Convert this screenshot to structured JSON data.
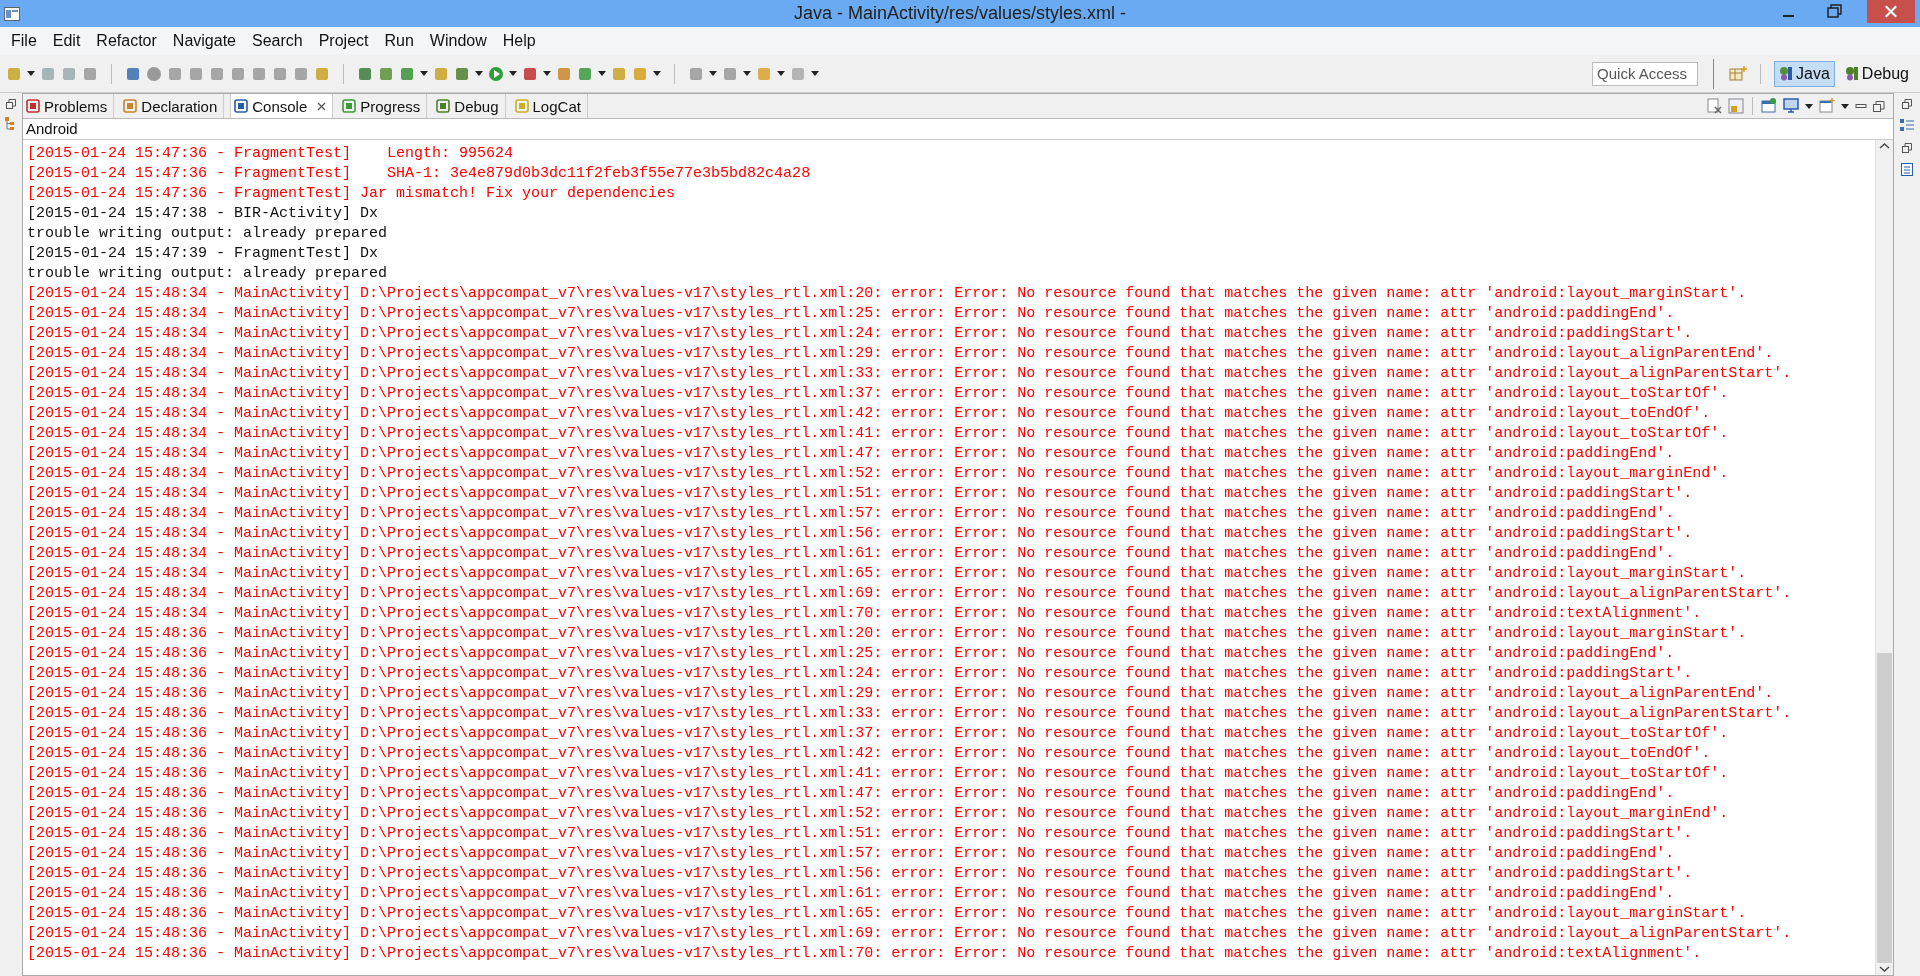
{
  "window": {
    "title": "Java - MainActivity/res/values/styles.xml -"
  },
  "menu": [
    "File",
    "Edit",
    "Refactor",
    "Navigate",
    "Search",
    "Project",
    "Run",
    "Window",
    "Help"
  ],
  "quick_access": {
    "placeholder": "Quick Access"
  },
  "perspectives": [
    {
      "label": "Java",
      "selected": true
    },
    {
      "label": "Debug",
      "selected": false
    }
  ],
  "tabs": [
    {
      "label": "Problems",
      "selected": false
    },
    {
      "label": "Declaration",
      "selected": false
    },
    {
      "label": "Console",
      "selected": true
    },
    {
      "label": "Progress",
      "selected": false
    },
    {
      "label": "Debug",
      "selected": false
    },
    {
      "label": "LogCat",
      "selected": false
    }
  ],
  "console": {
    "title": "Android",
    "lines": [
      {
        "kind": "error",
        "text": "[2015-01-24 15:47:36 - FragmentTest]    Length: 995624"
      },
      {
        "kind": "error",
        "text": "[2015-01-24 15:47:36 - FragmentTest]    SHA-1: 3e4e879d0b3dc11f2feb3f55e77e3b5bd82c4a28"
      },
      {
        "kind": "error",
        "text": "[2015-01-24 15:47:36 - FragmentTest] Jar mismatch! Fix your dependencies"
      },
      {
        "kind": "info",
        "text": "[2015-01-24 15:47:38 - BIR-Activity] Dx"
      },
      {
        "kind": "info",
        "text": "trouble writing output: already prepared"
      },
      {
        "kind": "info",
        "text": "[2015-01-24 15:47:39 - FragmentTest] Dx"
      },
      {
        "kind": "info",
        "text": "trouble writing output: already prepared"
      },
      {
        "kind": "error",
        "text": "[2015-01-24 15:48:34 - MainActivity] D:\\Projects\\appcompat_v7\\res\\values-v17\\styles_rtl.xml:20: error: Error: No resource found that matches the given name: attr 'android:layout_marginStart'."
      },
      {
        "kind": "error",
        "text": "[2015-01-24 15:48:34 - MainActivity] D:\\Projects\\appcompat_v7\\res\\values-v17\\styles_rtl.xml:25: error: Error: No resource found that matches the given name: attr 'android:paddingEnd'."
      },
      {
        "kind": "error",
        "text": "[2015-01-24 15:48:34 - MainActivity] D:\\Projects\\appcompat_v7\\res\\values-v17\\styles_rtl.xml:24: error: Error: No resource found that matches the given name: attr 'android:paddingStart'."
      },
      {
        "kind": "error",
        "text": "[2015-01-24 15:48:34 - MainActivity] D:\\Projects\\appcompat_v7\\res\\values-v17\\styles_rtl.xml:29: error: Error: No resource found that matches the given name: attr 'android:layout_alignParentEnd'."
      },
      {
        "kind": "error",
        "text": "[2015-01-24 15:48:34 - MainActivity] D:\\Projects\\appcompat_v7\\res\\values-v17\\styles_rtl.xml:33: error: Error: No resource found that matches the given name: attr 'android:layout_alignParentStart'."
      },
      {
        "kind": "error",
        "text": "[2015-01-24 15:48:34 - MainActivity] D:\\Projects\\appcompat_v7\\res\\values-v17\\styles_rtl.xml:37: error: Error: No resource found that matches the given name: attr 'android:layout_toStartOf'."
      },
      {
        "kind": "error",
        "text": "[2015-01-24 15:48:34 - MainActivity] D:\\Projects\\appcompat_v7\\res\\values-v17\\styles_rtl.xml:42: error: Error: No resource found that matches the given name: attr 'android:layout_toEndOf'."
      },
      {
        "kind": "error",
        "text": "[2015-01-24 15:48:34 - MainActivity] D:\\Projects\\appcompat_v7\\res\\values-v17\\styles_rtl.xml:41: error: Error: No resource found that matches the given name: attr 'android:layout_toStartOf'."
      },
      {
        "kind": "error",
        "text": "[2015-01-24 15:48:34 - MainActivity] D:\\Projects\\appcompat_v7\\res\\values-v17\\styles_rtl.xml:47: error: Error: No resource found that matches the given name: attr 'android:paddingEnd'."
      },
      {
        "kind": "error",
        "text": "[2015-01-24 15:48:34 - MainActivity] D:\\Projects\\appcompat_v7\\res\\values-v17\\styles_rtl.xml:52: error: Error: No resource found that matches the given name: attr 'android:layout_marginEnd'."
      },
      {
        "kind": "error",
        "text": "[2015-01-24 15:48:34 - MainActivity] D:\\Projects\\appcompat_v7\\res\\values-v17\\styles_rtl.xml:51: error: Error: No resource found that matches the given name: attr 'android:paddingStart'."
      },
      {
        "kind": "error",
        "text": "[2015-01-24 15:48:34 - MainActivity] D:\\Projects\\appcompat_v7\\res\\values-v17\\styles_rtl.xml:57: error: Error: No resource found that matches the given name: attr 'android:paddingEnd'."
      },
      {
        "kind": "error",
        "text": "[2015-01-24 15:48:34 - MainActivity] D:\\Projects\\appcompat_v7\\res\\values-v17\\styles_rtl.xml:56: error: Error: No resource found that matches the given name: attr 'android:paddingStart'."
      },
      {
        "kind": "error",
        "text": "[2015-01-24 15:48:34 - MainActivity] D:\\Projects\\appcompat_v7\\res\\values-v17\\styles_rtl.xml:61: error: Error: No resource found that matches the given name: attr 'android:paddingEnd'."
      },
      {
        "kind": "error",
        "text": "[2015-01-24 15:48:34 - MainActivity] D:\\Projects\\appcompat_v7\\res\\values-v17\\styles_rtl.xml:65: error: Error: No resource found that matches the given name: attr 'android:layout_marginStart'."
      },
      {
        "kind": "error",
        "text": "[2015-01-24 15:48:34 - MainActivity] D:\\Projects\\appcompat_v7\\res\\values-v17\\styles_rtl.xml:69: error: Error: No resource found that matches the given name: attr 'android:layout_alignParentStart'."
      },
      {
        "kind": "error",
        "text": "[2015-01-24 15:48:34 - MainActivity] D:\\Projects\\appcompat_v7\\res\\values-v17\\styles_rtl.xml:70: error: Error: No resource found that matches the given name: attr 'android:textAlignment'."
      },
      {
        "kind": "error",
        "text": "[2015-01-24 15:48:36 - MainActivity] D:\\Projects\\appcompat_v7\\res\\values-v17\\styles_rtl.xml:20: error: Error: No resource found that matches the given name: attr 'android:layout_marginStart'."
      },
      {
        "kind": "error",
        "text": "[2015-01-24 15:48:36 - MainActivity] D:\\Projects\\appcompat_v7\\res\\values-v17\\styles_rtl.xml:25: error: Error: No resource found that matches the given name: attr 'android:paddingEnd'."
      },
      {
        "kind": "error",
        "text": "[2015-01-24 15:48:36 - MainActivity] D:\\Projects\\appcompat_v7\\res\\values-v17\\styles_rtl.xml:24: error: Error: No resource found that matches the given name: attr 'android:paddingStart'."
      },
      {
        "kind": "error",
        "text": "[2015-01-24 15:48:36 - MainActivity] D:\\Projects\\appcompat_v7\\res\\values-v17\\styles_rtl.xml:29: error: Error: No resource found that matches the given name: attr 'android:layout_alignParentEnd'."
      },
      {
        "kind": "error",
        "text": "[2015-01-24 15:48:36 - MainActivity] D:\\Projects\\appcompat_v7\\res\\values-v17\\styles_rtl.xml:33: error: Error: No resource found that matches the given name: attr 'android:layout_alignParentStart'."
      },
      {
        "kind": "error",
        "text": "[2015-01-24 15:48:36 - MainActivity] D:\\Projects\\appcompat_v7\\res\\values-v17\\styles_rtl.xml:37: error: Error: No resource found that matches the given name: attr 'android:layout_toStartOf'."
      },
      {
        "kind": "error",
        "text": "[2015-01-24 15:48:36 - MainActivity] D:\\Projects\\appcompat_v7\\res\\values-v17\\styles_rtl.xml:42: error: Error: No resource found that matches the given name: attr 'android:layout_toEndOf'."
      },
      {
        "kind": "error",
        "text": "[2015-01-24 15:48:36 - MainActivity] D:\\Projects\\appcompat_v7\\res\\values-v17\\styles_rtl.xml:41: error: Error: No resource found that matches the given name: attr 'android:layout_toStartOf'."
      },
      {
        "kind": "error",
        "text": "[2015-01-24 15:48:36 - MainActivity] D:\\Projects\\appcompat_v7\\res\\values-v17\\styles_rtl.xml:47: error: Error: No resource found that matches the given name: attr 'android:paddingEnd'."
      },
      {
        "kind": "error",
        "text": "[2015-01-24 15:48:36 - MainActivity] D:\\Projects\\appcompat_v7\\res\\values-v17\\styles_rtl.xml:52: error: Error: No resource found that matches the given name: attr 'android:layout_marginEnd'."
      },
      {
        "kind": "error",
        "text": "[2015-01-24 15:48:36 - MainActivity] D:\\Projects\\appcompat_v7\\res\\values-v17\\styles_rtl.xml:51: error: Error: No resource found that matches the given name: attr 'android:paddingStart'."
      },
      {
        "kind": "error",
        "text": "[2015-01-24 15:48:36 - MainActivity] D:\\Projects\\appcompat_v7\\res\\values-v17\\styles_rtl.xml:57: error: Error: No resource found that matches the given name: attr 'android:paddingEnd'."
      },
      {
        "kind": "error",
        "text": "[2015-01-24 15:48:36 - MainActivity] D:\\Projects\\appcompat_v7\\res\\values-v17\\styles_rtl.xml:56: error: Error: No resource found that matches the given name: attr 'android:paddingStart'."
      },
      {
        "kind": "error",
        "text": "[2015-01-24 15:48:36 - MainActivity] D:\\Projects\\appcompat_v7\\res\\values-v17\\styles_rtl.xml:61: error: Error: No resource found that matches the given name: attr 'android:paddingEnd'."
      },
      {
        "kind": "error",
        "text": "[2015-01-24 15:48:36 - MainActivity] D:\\Projects\\appcompat_v7\\res\\values-v17\\styles_rtl.xml:65: error: Error: No resource found that matches the given name: attr 'android:layout_marginStart'."
      },
      {
        "kind": "error",
        "text": "[2015-01-24 15:48:36 - MainActivity] D:\\Projects\\appcompat_v7\\res\\values-v17\\styles_rtl.xml:69: error: Error: No resource found that matches the given name: attr 'android:layout_alignParentStart'."
      },
      {
        "kind": "error",
        "text": "[2015-01-24 15:48:36 - MainActivity] D:\\Projects\\appcompat_v7\\res\\values-v17\\styles_rtl.xml:70: error: Error: No resource found that matches the given name: attr 'android:textAlignment'."
      }
    ]
  }
}
